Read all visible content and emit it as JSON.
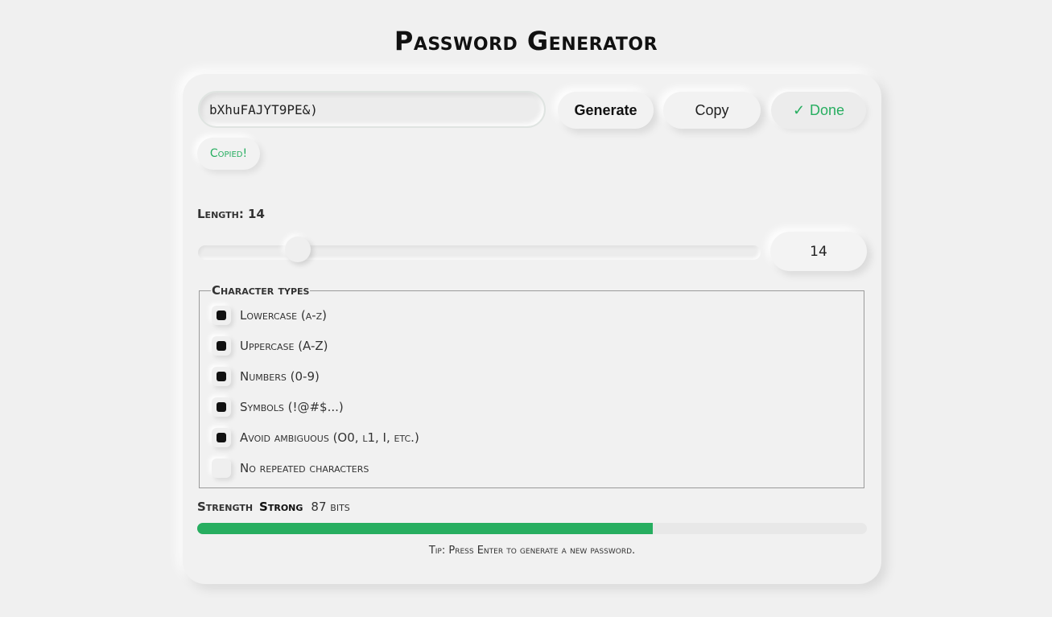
{
  "title": "Password Generator",
  "password": {
    "value": "bXhuFAJYT9PE&)"
  },
  "buttons": {
    "generate": "Generate",
    "copy": "Copy",
    "done": "Done",
    "done_icon": "check-icon"
  },
  "copied_badge": "Copied!",
  "length": {
    "label": "Length: 14",
    "value": "14",
    "slider_fraction": 0.155
  },
  "character_types": {
    "legend": "Character types",
    "options": [
      {
        "label": "Lowercase (a-z)",
        "checked": true
      },
      {
        "label": "Uppercase (A-Z)",
        "checked": true
      },
      {
        "label": "Numbers (0-9)",
        "checked": true
      },
      {
        "label": "Symbols (!@#$...)",
        "checked": true
      },
      {
        "label": "Avoid ambiguous (O0, l1, I, etc.)",
        "checked": true
      },
      {
        "label": "No repeated characters",
        "checked": false
      }
    ]
  },
  "strength": {
    "label": "Strength",
    "value": "Strong",
    "bits": "87 bits",
    "fraction": 0.68,
    "color": "#27ae60"
  },
  "tip": "Tip: Press Enter to generate a new password.",
  "colors": {
    "accent": "#27ae60",
    "background": "#f0f0f0"
  }
}
